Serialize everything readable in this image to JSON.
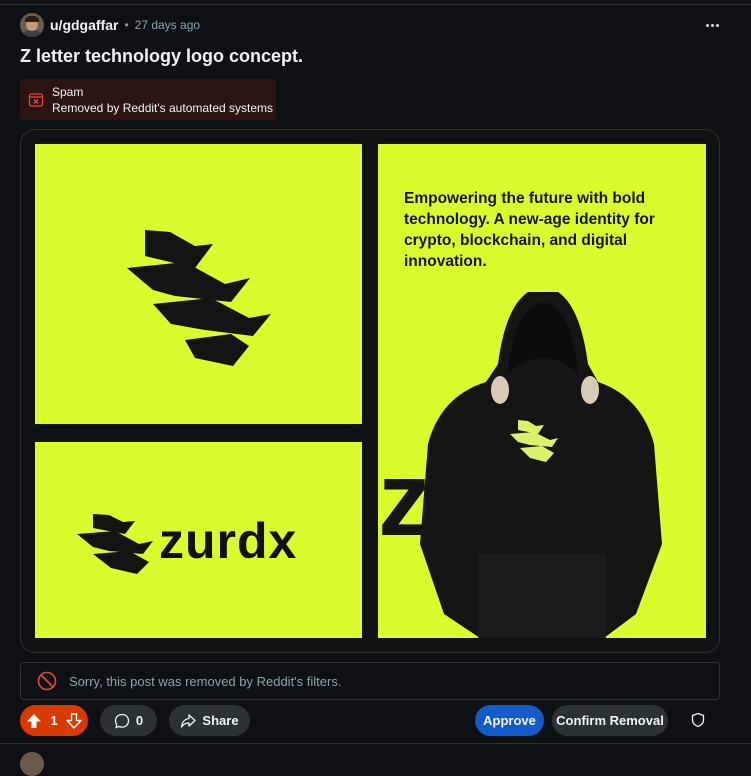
{
  "post": {
    "username": "u/gdgaffar",
    "separator": "•",
    "time_ago": "27 days ago",
    "title": "Z letter technology logo concept."
  },
  "removal_badge": {
    "label": "Spam",
    "detail": "Removed by Reddit's automated systems"
  },
  "image": {
    "tagline": "Empowering the future with bold technology. A new-age identity for crypto, blockchain, and digital innovation.",
    "wordmark": "zurdx",
    "big_wordmark": "zurdx",
    "accent_color": "#dcfb2c"
  },
  "notice": {
    "text": "Sorry, this post was removed by Reddit's filters."
  },
  "actions": {
    "vote_count": "1",
    "comment_count": "0",
    "share_label": "Share",
    "approve_label": "Approve",
    "confirm_removal_label": "Confirm Removal"
  },
  "icons": [
    "avatar",
    "more-icon",
    "spam-removed-icon",
    "upvote-icon",
    "downvote-icon",
    "comment-icon",
    "share-icon",
    "prohibited-icon",
    "shield-icon"
  ],
  "colors": {
    "background": "#0e1113",
    "upvote_active": "#d93a00",
    "approve": "#115bca"
  }
}
